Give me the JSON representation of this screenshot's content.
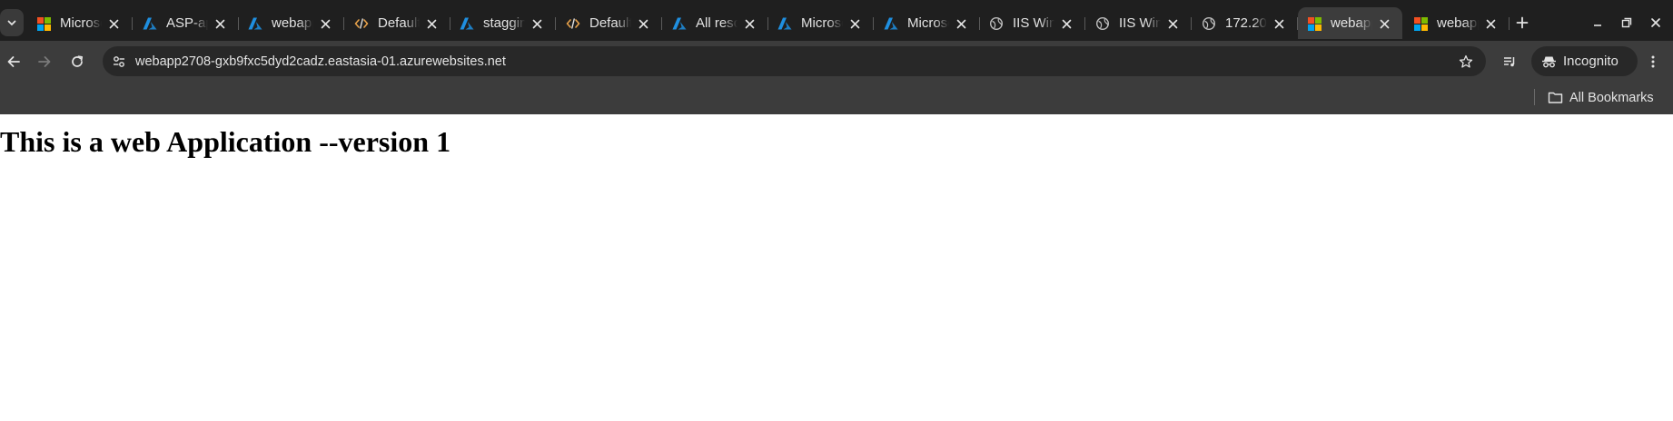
{
  "browser": {
    "tabs": [
      {
        "title": "Microsoft",
        "icon": "microsoft-logo-icon",
        "active": false
      },
      {
        "title": "ASP-app",
        "icon": "azure-icon",
        "active": false
      },
      {
        "title": "webapp",
        "icon": "azure-icon",
        "active": false
      },
      {
        "title": "Default",
        "icon": "code-icon",
        "active": false
      },
      {
        "title": "staggin",
        "icon": "azure-icon",
        "active": false
      },
      {
        "title": "Default",
        "icon": "code-icon",
        "active": false
      },
      {
        "title": "All resources",
        "icon": "azure-icon",
        "active": false
      },
      {
        "title": "Microsoft",
        "icon": "azure-icon",
        "active": false
      },
      {
        "title": "Microsoft",
        "icon": "azure-icon",
        "active": false
      },
      {
        "title": "IIS Windows",
        "icon": "globe-icon",
        "active": false
      },
      {
        "title": "IIS Windows",
        "icon": "globe-icon",
        "active": false
      },
      {
        "title": "172.20",
        "icon": "globe-icon",
        "active": false
      },
      {
        "title": "webapp",
        "icon": "microsoft-logo-icon",
        "active": true
      },
      {
        "title": "webapp",
        "icon": "microsoft-logo-icon",
        "active": false
      }
    ],
    "address_bar": {
      "url": "webapp2708-gxb9fxc5dyd2cadz.eastasia-01.azurewebsites.net"
    },
    "profile": {
      "label": "Incognito"
    },
    "bookmarks": {
      "all_bookmarks_label": "All Bookmarks"
    },
    "colors": {
      "tab_strip": "#1f1f1f",
      "toolbar": "#3c3c3c",
      "omnibox": "#282828",
      "text": "#e3e3e3",
      "azure_blue": "#1f8fe0",
      "ms_red": "#f25022",
      "ms_green": "#7fba00",
      "ms_blue": "#00a4ef",
      "ms_yellow": "#ffb900"
    }
  },
  "page": {
    "heading": "This is a web Application --version 1"
  }
}
